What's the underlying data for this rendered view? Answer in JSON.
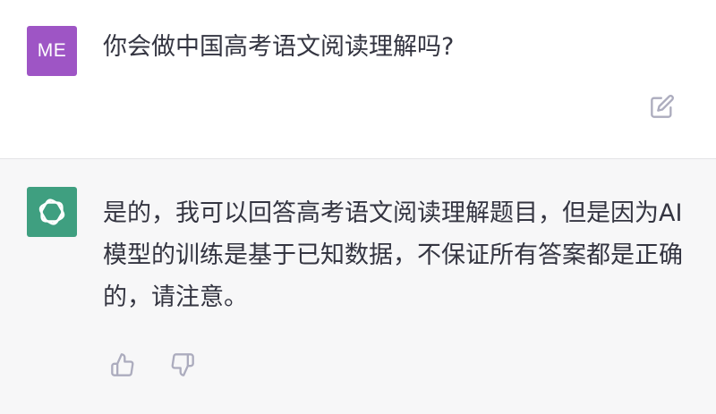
{
  "user": {
    "avatar_initials": "ME",
    "avatar_color": "#9e55c5",
    "message": "你会做中国高考语文阅读理解吗?"
  },
  "assistant": {
    "avatar_icon": "openai-logo-icon",
    "avatar_color": "#3f9f80",
    "message": "是的，我可以回答高考语文阅读理解题目，但是因为AI模型的训练是基于已知数据，不保证所有答案都是正确的，请注意。"
  },
  "actions": {
    "edit_icon": "edit-icon",
    "like_icon": "thumbs-up-icon",
    "dislike_icon": "thumbs-down-icon"
  },
  "colors": {
    "user_background": "#ffffff",
    "assistant_background": "#f7f7f8",
    "text": "#343541",
    "icon": "#acacbe"
  }
}
